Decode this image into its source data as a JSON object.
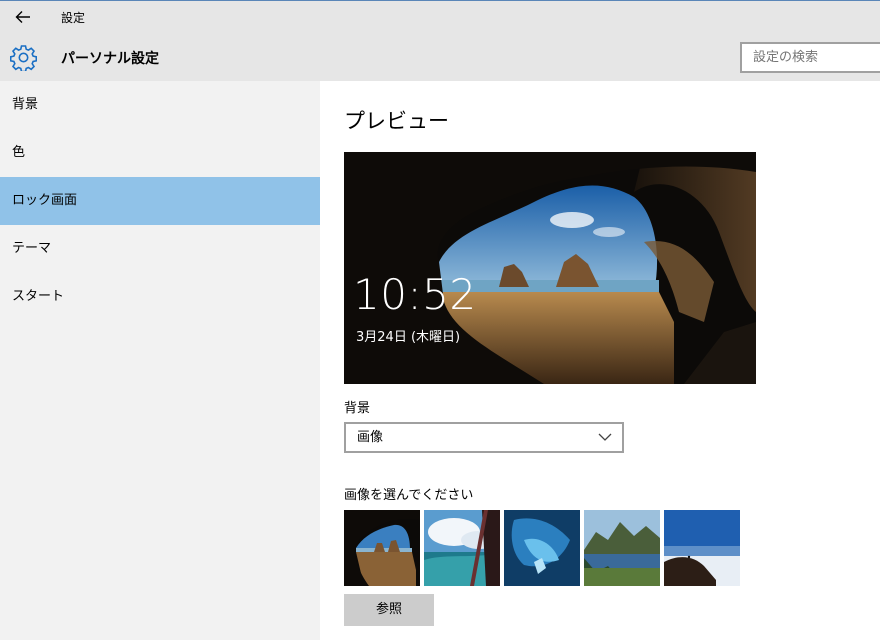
{
  "window": {
    "title": "設定"
  },
  "header": {
    "page_title": "パーソナル設定",
    "search_placeholder": "設定の検索"
  },
  "sidebar": {
    "items": [
      {
        "label": "背景"
      },
      {
        "label": "色"
      },
      {
        "label": "ロック画面",
        "active": true
      },
      {
        "label": "テーマ"
      },
      {
        "label": "スタート"
      }
    ]
  },
  "main": {
    "preview_title": "プレビュー",
    "preview": {
      "time": "10:52",
      "date": "3月24日 (木曜日)"
    },
    "background_label": "背景",
    "background_value": "画像",
    "choose_label": "画像を選んでください",
    "browse_label": "参照"
  },
  "colors": {
    "accent": "#90c2e8",
    "sidebar_bg": "#f2f2f2",
    "header_bg": "#e6e6e6",
    "gear": "#1a6fc4"
  }
}
